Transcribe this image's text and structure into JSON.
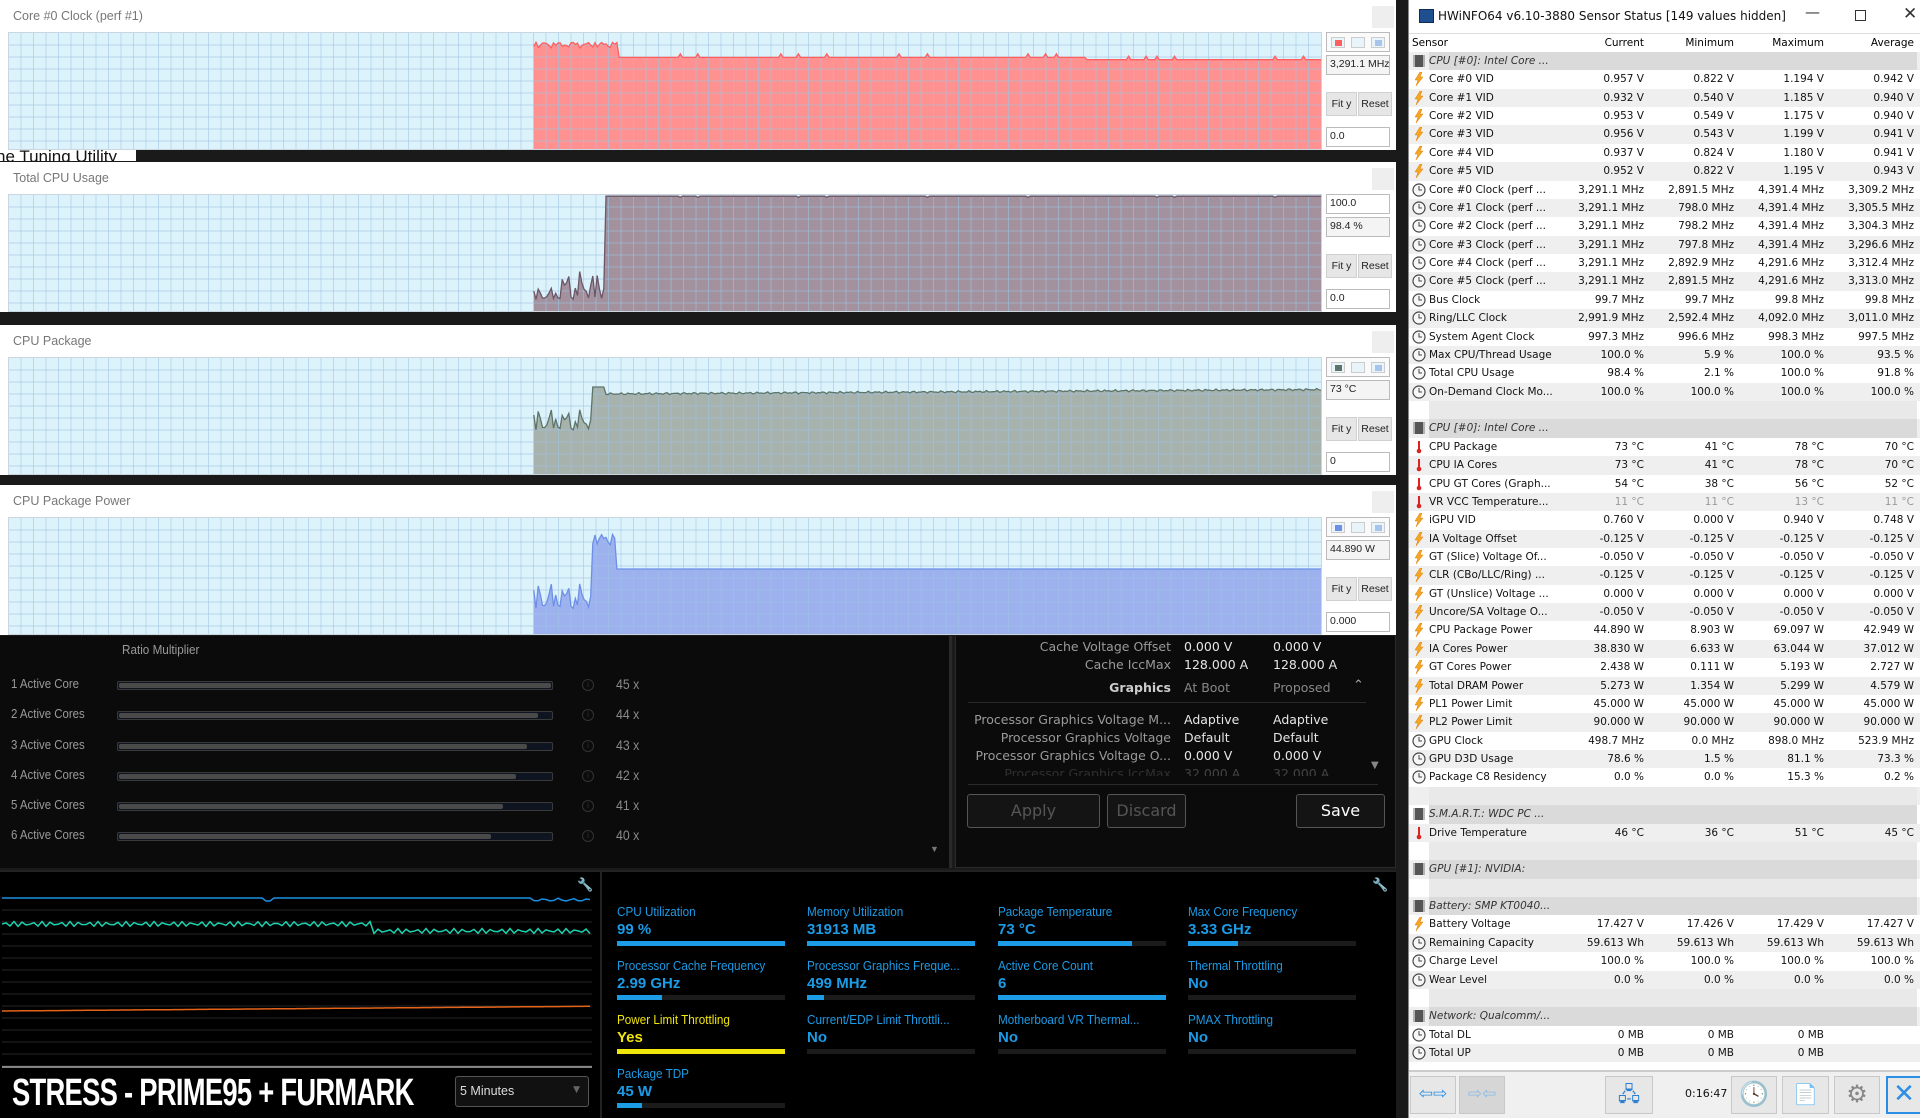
{
  "background_fragment": "ne Tuning Utility",
  "graphs": [
    {
      "title": "Core #0 Clock (perf #1)",
      "top_value": "",
      "current": "3,291.1 MHz",
      "bottom_value": "0.0",
      "fit_label": "Fit y",
      "reset_label": "Reset",
      "color": "#ff5f5f",
      "fill": "#ff9191",
      "has_swatches": true
    },
    {
      "title": "Total CPU Usage",
      "top_value": "100.0",
      "current": "98.4 %",
      "bottom_value": "0.0",
      "fit_label": "Fit y",
      "reset_label": "Reset",
      "color": "#6b5566",
      "fill": "#a3929e",
      "has_swatches": false
    },
    {
      "title": "CPU Package",
      "top_value": "",
      "current": "73 °C",
      "bottom_value": "0",
      "fit_label": "Fit y",
      "reset_label": "Reset",
      "color": "#5d7468",
      "fill": "#a8b2ac",
      "has_swatches": true
    },
    {
      "title": "CPU Package Power",
      "top_value": "",
      "current": "44.890 W",
      "bottom_value": "0.000",
      "fit_label": "Fit y",
      "reset_label": "Reset",
      "color": "#6d8fe8",
      "fill": "#9db1ef",
      "has_swatches": true
    }
  ],
  "ratio_panel": {
    "heading": "Ratio Multiplier",
    "rows": [
      {
        "label": "1 Active Core",
        "value": "45 x",
        "fill_percent": 100
      },
      {
        "label": "2 Active Cores",
        "value": "44 x",
        "fill_percent": 97
      },
      {
        "label": "3 Active Cores",
        "value": "43 x",
        "fill_percent": 94.5
      },
      {
        "label": "4 Active Cores",
        "value": "42 x",
        "fill_percent": 92
      },
      {
        "label": "5 Active Cores",
        "value": "41 x",
        "fill_percent": 89
      },
      {
        "label": "6 Active Cores",
        "value": "40 x",
        "fill_percent": 86
      }
    ]
  },
  "settings_panel": {
    "rows": [
      {
        "label": "Cache Voltage Offset",
        "at_boot": "0.000 V",
        "proposed": "0.000 V"
      },
      {
        "label": "Cache IccMax",
        "at_boot": "128.000 A",
        "proposed": "128.000 A"
      }
    ],
    "section": {
      "label": "Graphics",
      "col1": "At Boot",
      "col2": "Proposed"
    },
    "graphics_rows": [
      {
        "label": "Processor Graphics Voltage M...",
        "at_boot": "Adaptive",
        "proposed": "Adaptive"
      },
      {
        "label": "Processor Graphics Voltage",
        "at_boot": "Default",
        "proposed": "Default"
      },
      {
        "label": "Processor Graphics Voltage O...",
        "at_boot": "0.000 V",
        "proposed": "0.000 V"
      },
      {
        "label": "Processor Graphics IccMax",
        "at_boot": "32.000 A",
        "proposed": "32.000 A"
      }
    ],
    "apply_label": "Apply",
    "discard_label": "Discard",
    "save_label": "Save"
  },
  "monitor": {
    "profile_name": "STRESS - PRIME95 + FURMARK",
    "time_range": "5 Minutes",
    "line_colors": [
      "#1a8fe0",
      "#19d3b0",
      "#e4631a"
    ]
  },
  "stats": [
    {
      "label": "CPU Utilization",
      "value": "99 %",
      "fill_percent": 100
    },
    {
      "label": "Memory Utilization",
      "value": "31913  MB",
      "fill_percent": 100
    },
    {
      "label": "Package Temperature",
      "value": "73 °C",
      "fill_percent": 80
    },
    {
      "label": "Max Core Frequency",
      "value": "3.33 GHz",
      "fill_percent": 30
    },
    {
      "label": "Processor Cache Frequency",
      "value": "2.99 GHz",
      "fill_percent": 27
    },
    {
      "label": "Processor Graphics Freque...",
      "value": "499 MHz",
      "fill_percent": 10
    },
    {
      "label": "Active Core Count",
      "value": "6",
      "fill_percent": 100
    },
    {
      "label": "Thermal Throttling",
      "value": "No",
      "fill_percent": 0
    },
    {
      "label": "Power Limit Throttling",
      "value": "Yes",
      "fill_percent": 100,
      "warn": true
    },
    {
      "label": "Current/EDP Limit Throttli...",
      "value": "No",
      "fill_percent": 0
    },
    {
      "label": "Motherboard VR Thermal...",
      "value": "No",
      "fill_percent": 0
    },
    {
      "label": "PMAX Throttling",
      "value": "No",
      "fill_percent": 0
    },
    {
      "label": "Package TDP",
      "value": "45 W",
      "fill_percent": 15
    }
  ],
  "hwinfo": {
    "title": "HWiNFO64 v6.10-3880 Sensor Status [149 values hidden]",
    "columns": [
      "Sensor",
      "Current",
      "Minimum",
      "Maximum",
      "Average"
    ],
    "rows": [
      {
        "t": "g",
        "n": "CPU [#0]: Intel Core ..."
      },
      {
        "i": "bolt",
        "n": "Core #0 VID",
        "v": [
          "0.957 V",
          "0.822 V",
          "1.194 V",
          "0.942 V"
        ]
      },
      {
        "i": "bolt",
        "n": "Core #1 VID",
        "v": [
          "0.932 V",
          "0.540 V",
          "1.185 V",
          "0.940 V"
        ]
      },
      {
        "i": "bolt",
        "n": "Core #2 VID",
        "v": [
          "0.953 V",
          "0.549 V",
          "1.175 V",
          "0.940 V"
        ]
      },
      {
        "i": "bolt",
        "n": "Core #3 VID",
        "v": [
          "0.956 V",
          "0.543 V",
          "1.199 V",
          "0.941 V"
        ]
      },
      {
        "i": "bolt",
        "n": "Core #4 VID",
        "v": [
          "0.937 V",
          "0.824 V",
          "1.180 V",
          "0.941 V"
        ]
      },
      {
        "i": "bolt",
        "n": "Core #5 VID",
        "v": [
          "0.952 V",
          "0.822 V",
          "1.195 V",
          "0.943 V"
        ]
      },
      {
        "i": "clock",
        "n": "Core #0 Clock (perf ...",
        "v": [
          "3,291.1 MHz",
          "2,891.5 MHz",
          "4,391.4 MHz",
          "3,309.2 MHz"
        ]
      },
      {
        "i": "clock",
        "n": "Core #1 Clock (perf ...",
        "v": [
          "3,291.1 MHz",
          "798.0 MHz",
          "4,391.4 MHz",
          "3,305.5 MHz"
        ]
      },
      {
        "i": "clock",
        "n": "Core #2 Clock (perf ...",
        "v": [
          "3,291.1 MHz",
          "798.2 MHz",
          "4,391.4 MHz",
          "3,304.3 MHz"
        ]
      },
      {
        "i": "clock",
        "n": "Core #3 Clock (perf ...",
        "v": [
          "3,291.1 MHz",
          "797.8 MHz",
          "4,391.4 MHz",
          "3,296.6 MHz"
        ]
      },
      {
        "i": "clock",
        "n": "Core #4 Clock (perf ...",
        "v": [
          "3,291.1 MHz",
          "2,892.9 MHz",
          "4,291.6 MHz",
          "3,312.4 MHz"
        ]
      },
      {
        "i": "clock",
        "n": "Core #5 Clock (perf ...",
        "v": [
          "3,291.1 MHz",
          "2,891.5 MHz",
          "4,291.6 MHz",
          "3,313.0 MHz"
        ]
      },
      {
        "i": "clock",
        "n": "Bus Clock",
        "v": [
          "99.7 MHz",
          "99.7 MHz",
          "99.8 MHz",
          "99.8 MHz"
        ]
      },
      {
        "i": "clock",
        "n": "Ring/LLC Clock",
        "v": [
          "2,991.9 MHz",
          "2,592.4 MHz",
          "4,092.0 MHz",
          "3,011.0 MHz"
        ]
      },
      {
        "i": "clock",
        "n": "System Agent Clock",
        "v": [
          "997.3 MHz",
          "996.6 MHz",
          "998.3 MHz",
          "997.5 MHz"
        ]
      },
      {
        "i": "clock",
        "n": "Max CPU/Thread Usage",
        "v": [
          "100.0 %",
          "5.9 %",
          "100.0 %",
          "93.5 %"
        ]
      },
      {
        "i": "clock",
        "n": "Total CPU Usage",
        "v": [
          "98.4 %",
          "2.1 %",
          "100.0 %",
          "91.8 %"
        ]
      },
      {
        "i": "clock",
        "n": "On-Demand Clock Mo...",
        "v": [
          "100.0 %",
          "100.0 %",
          "100.0 %",
          "100.0 %"
        ]
      },
      {
        "t": "b"
      },
      {
        "t": "g",
        "n": "CPU [#0]: Intel Core ..."
      },
      {
        "i": "temp",
        "n": "CPU Package",
        "v": [
          "73 °C",
          "41 °C",
          "78 °C",
          "70 °C"
        ]
      },
      {
        "i": "temp",
        "n": "CPU IA Cores",
        "v": [
          "73 °C",
          "41 °C",
          "78 °C",
          "70 °C"
        ]
      },
      {
        "i": "temp",
        "n": "CPU GT Cores (Graph...",
        "v": [
          "54 °C",
          "38 °C",
          "56 °C",
          "52 °C"
        ]
      },
      {
        "i": "temp",
        "n": "VR VCC Temperature...",
        "v": [
          "11 °C",
          "11 °C",
          "13 °C",
          "11 °C"
        ],
        "dim": true
      },
      {
        "i": "bolt",
        "n": "iGPU VID",
        "v": [
          "0.760 V",
          "0.000 V",
          "0.940 V",
          "0.748 V"
        ]
      },
      {
        "i": "bolt",
        "n": "IA Voltage Offset",
        "v": [
          "-0.125 V",
          "-0.125 V",
          "-0.125 V",
          "-0.125 V"
        ]
      },
      {
        "i": "bolt",
        "n": "GT (Slice) Voltage Of...",
        "v": [
          "-0.050 V",
          "-0.050 V",
          "-0.050 V",
          "-0.050 V"
        ]
      },
      {
        "i": "bolt",
        "n": "CLR (CBo/LLC/Ring) ...",
        "v": [
          "-0.125 V",
          "-0.125 V",
          "-0.125 V",
          "-0.125 V"
        ]
      },
      {
        "i": "bolt",
        "n": "GT (Unslice) Voltage ...",
        "v": [
          "0.000 V",
          "0.000 V",
          "0.000 V",
          "0.000 V"
        ]
      },
      {
        "i": "bolt",
        "n": "Uncore/SA Voltage O...",
        "v": [
          "-0.050 V",
          "-0.050 V",
          "-0.050 V",
          "-0.050 V"
        ]
      },
      {
        "i": "bolt",
        "n": "CPU Package Power",
        "v": [
          "44.890 W",
          "8.903 W",
          "69.097 W",
          "42.949 W"
        ]
      },
      {
        "i": "bolt",
        "n": "IA Cores Power",
        "v": [
          "38.830 W",
          "6.633 W",
          "63.044 W",
          "37.012 W"
        ]
      },
      {
        "i": "bolt",
        "n": "GT Cores Power",
        "v": [
          "2.438 W",
          "0.111 W",
          "5.193 W",
          "2.727 W"
        ]
      },
      {
        "i": "bolt",
        "n": "Total DRAM Power",
        "v": [
          "5.273 W",
          "1.354 W",
          "5.299 W",
          "4.579 W"
        ]
      },
      {
        "i": "bolt",
        "n": "PL1 Power Limit",
        "v": [
          "45.000 W",
          "45.000 W",
          "45.000 W",
          "45.000 W"
        ]
      },
      {
        "i": "bolt",
        "n": "PL2 Power Limit",
        "v": [
          "90.000 W",
          "90.000 W",
          "90.000 W",
          "90.000 W"
        ]
      },
      {
        "i": "clock",
        "n": "GPU Clock",
        "v": [
          "498.7 MHz",
          "0.0 MHz",
          "898.0 MHz",
          "523.9 MHz"
        ]
      },
      {
        "i": "clock",
        "n": "GPU D3D Usage",
        "v": [
          "78.6 %",
          "1.5 %",
          "81.1 %",
          "73.3 %"
        ]
      },
      {
        "i": "clock",
        "n": "Package C8 Residency",
        "v": [
          "0.0 %",
          "0.0 %",
          "15.3 %",
          "0.2 %"
        ]
      },
      {
        "t": "b"
      },
      {
        "t": "g",
        "n": "S.M.A.R.T.: WDC PC ..."
      },
      {
        "i": "temp",
        "n": "Drive Temperature",
        "v": [
          "46 °C",
          "36 °C",
          "51 °C",
          "45 °C"
        ]
      },
      {
        "t": "b"
      },
      {
        "t": "g",
        "n": "GPU [#1]: NVIDIA:"
      },
      {
        "t": "b"
      },
      {
        "t": "g",
        "n": "Battery: SMP KT0040..."
      },
      {
        "i": "bolt",
        "n": "Battery Voltage",
        "v": [
          "17.427 V",
          "17.426 V",
          "17.429 V",
          "17.427 V"
        ]
      },
      {
        "i": "clock",
        "n": "Remaining Capacity",
        "v": [
          "59.613 Wh",
          "59.613 Wh",
          "59.613 Wh",
          "59.613 Wh"
        ]
      },
      {
        "i": "clock",
        "n": "Charge Level",
        "v": [
          "100.0 %",
          "100.0 %",
          "100.0 %",
          "100.0 %"
        ]
      },
      {
        "i": "clock",
        "n": "Wear Level",
        "v": [
          "0.0 %",
          "0.0 %",
          "0.0 %",
          "0.0 %"
        ]
      },
      {
        "t": "b"
      },
      {
        "t": "g",
        "n": "Network: Qualcomm/..."
      },
      {
        "i": "clock",
        "n": "Total DL",
        "v": [
          "0 MB",
          "0 MB",
          "0 MB",
          ""
        ]
      },
      {
        "i": "clock",
        "n": "Total UP",
        "v": [
          "0 MB",
          "0 MB",
          "0 MB",
          ""
        ]
      }
    ],
    "elapsed_time": "0:16:47"
  }
}
